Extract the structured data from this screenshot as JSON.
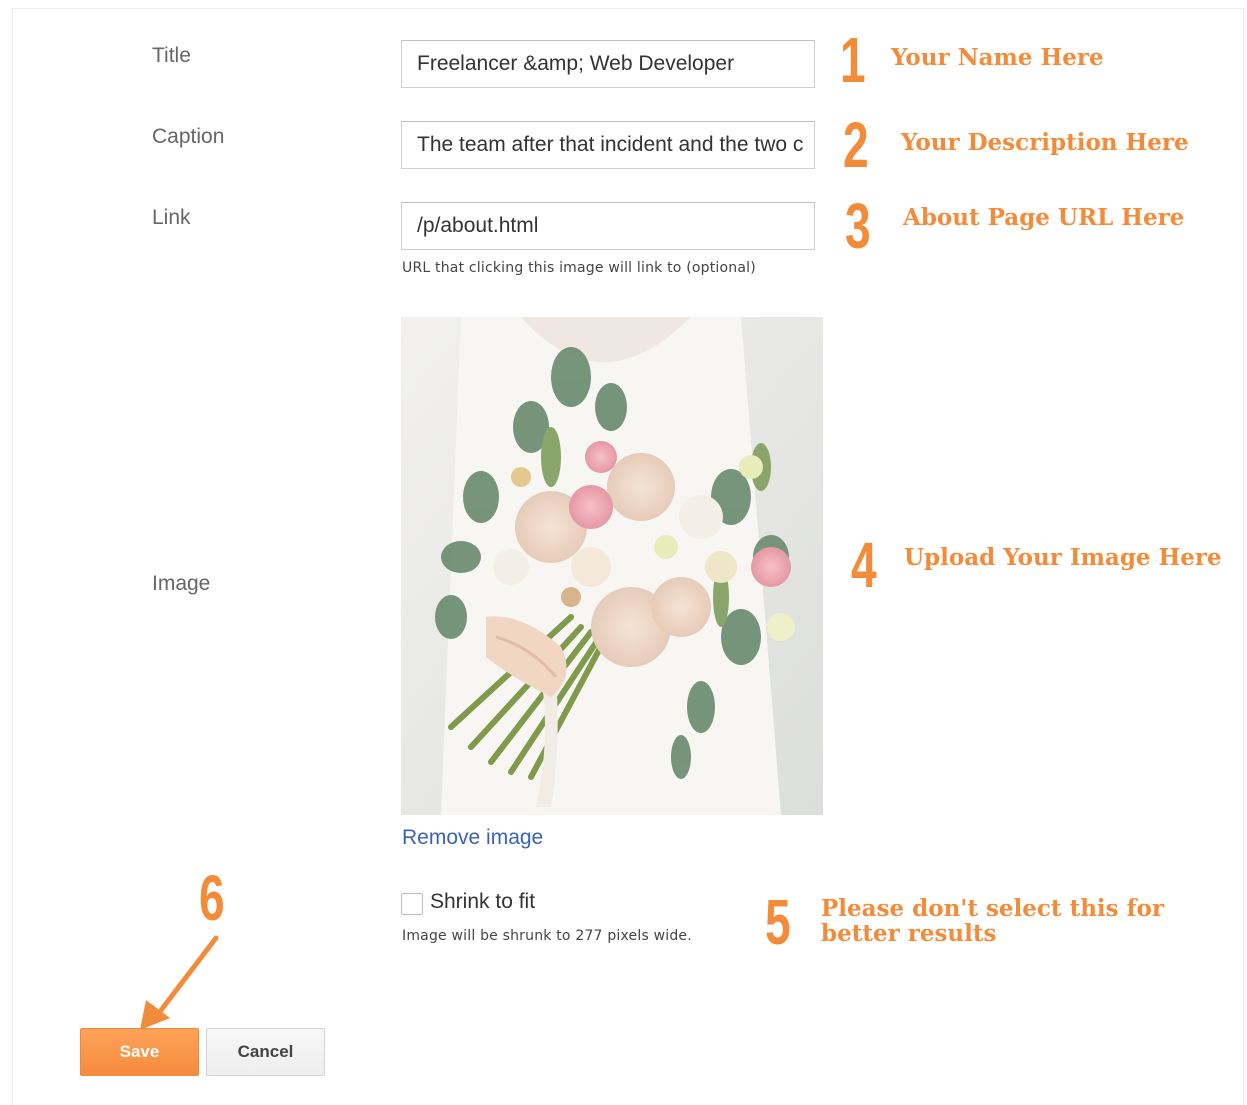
{
  "form": {
    "title_label": "Title",
    "title_value": "Freelancer &amp; Web Developer",
    "caption_label": "Caption",
    "caption_value": "The team after that incident and the two c",
    "link_label": "Link",
    "link_value": "/p/about.html",
    "link_hint": "URL that clicking this image will link to (optional)",
    "image_label": "Image",
    "remove_image": "Remove image",
    "shrink_label": "Shrink to fit",
    "shrink_checked": false,
    "shrink_hint": "Image will be shrunk to 277 pixels wide."
  },
  "buttons": {
    "save": "Save",
    "cancel": "Cancel"
  },
  "annotations": [
    {
      "number": "1",
      "text": "Your Name Here"
    },
    {
      "number": "2",
      "text": "Your Description Here"
    },
    {
      "number": "3",
      "text": "About Page URL Here"
    },
    {
      "number": "4",
      "text": "Upload Your Image Here"
    },
    {
      "number": "5",
      "text_line1": "Please don't select this for",
      "text_line2": "better results"
    },
    {
      "number": "6"
    }
  ],
  "colors": {
    "accent_orange": "#f28c3a",
    "link_blue": "#3b62b5"
  }
}
